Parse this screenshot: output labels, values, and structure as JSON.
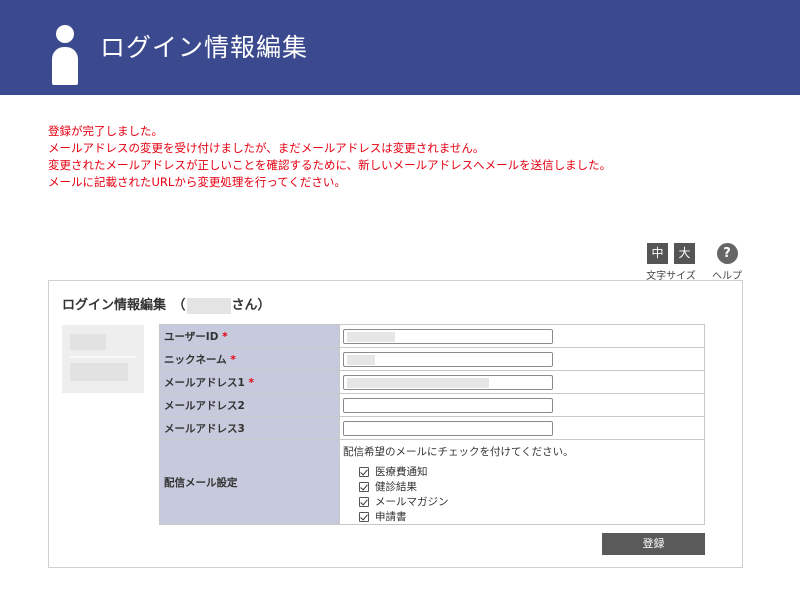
{
  "header": {
    "title": "ログイン情報編集"
  },
  "messages": [
    "登録が完了しました。",
    "メールアドレスの変更を受け付けましたが、まだメールアドレスは変更されません。",
    "変更されたメールアドレスが正しいことを確認するために、新しいメールアドレスへメールを送信しました。",
    "メールに記載されたURLから変更処理を行ってください。"
  ],
  "tools": {
    "size_medium": "中",
    "size_large": "大",
    "size_label": "文字サイズ",
    "help_symbol": "?",
    "help_label": "ヘルプ"
  },
  "panel": {
    "title_prefix": "ログイン情報編集　（",
    "title_suffix": "さん）"
  },
  "form": {
    "rows": [
      {
        "label": "ユーザーID",
        "required": "*"
      },
      {
        "label": "ニックネーム",
        "required": "*"
      },
      {
        "label": "メールアドレス1",
        "required": "*"
      },
      {
        "label": "メールアドレス2",
        "required": ""
      },
      {
        "label": "メールアドレス3",
        "required": ""
      }
    ],
    "delivery": {
      "label": "配信メール設定",
      "note": "配信希望のメールにチェックを付けてください。",
      "options": [
        "医療費通知",
        "健診結果",
        "メールマガジン",
        "申請書"
      ]
    }
  },
  "submit_label": "登録",
  "colors": {
    "header_bg": "#3b4a8f",
    "message_red": "#e60012",
    "label_bg": "#c6cadc",
    "button_bg": "#5a5a5a"
  }
}
